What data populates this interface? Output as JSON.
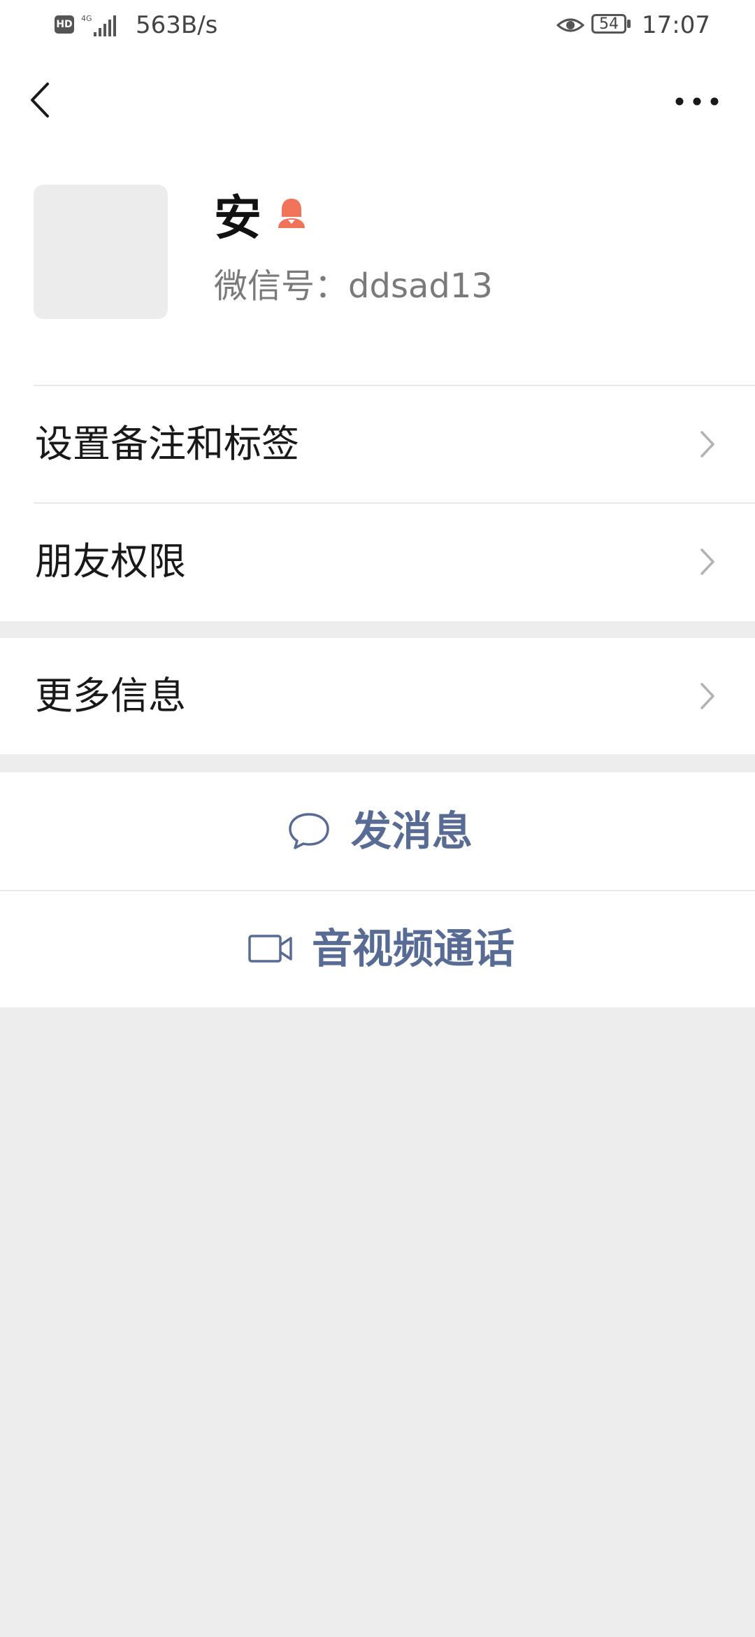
{
  "status_bar": {
    "hd": "HD",
    "network": "4G",
    "speed": "563B/s",
    "battery": "54",
    "time": "17:07"
  },
  "header": {
    "back_icon": "chevron-left-icon",
    "more_icon": "ellipsis-icon"
  },
  "profile": {
    "name": "安",
    "gender_icon": "female-icon",
    "gender_color": "#f0735a",
    "wechat_id": "微信号：ddsad13"
  },
  "menu": {
    "items": [
      {
        "label": "设置备注和标签"
      },
      {
        "label": "朋友权限"
      },
      {
        "label": "更多信息"
      }
    ]
  },
  "actions": [
    {
      "label": "发消息",
      "icon": "chat-bubble-icon"
    },
    {
      "label": "音视频通话",
      "icon": "video-camera-icon"
    }
  ],
  "colors": {
    "accent": "#576b95",
    "background": "#ededed"
  }
}
